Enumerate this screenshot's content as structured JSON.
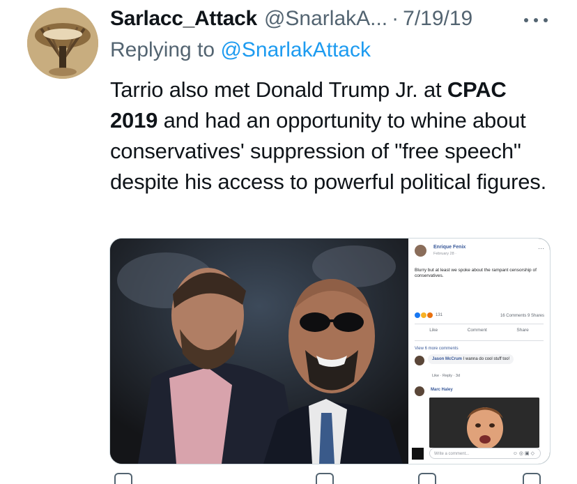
{
  "tweet": {
    "display_name": "Sarlacc_Attack",
    "handle": "@SnarlakA...",
    "separator": "·",
    "date": "7/19/19",
    "reply_prefix": "Replying to ",
    "reply_to": "@SnarlakAttack",
    "text_part1": "Tarrio also met Donald Trump Jr. at ",
    "text_bold": "CPAC 2019",
    "text_part2": " and had an opportunity to whine about conservatives' suppression of \"free speech\" despite his access to powerful political figures."
  },
  "icons": [
    "more-icon",
    "avatar-icon"
  ],
  "embedded_facebook_post": {
    "author": "Enrique Fenix",
    "date": "February 28 · ",
    "more": "···",
    "post_text": "Blurry but at least we spoke about the rampant censorship of conservatives.",
    "reaction_count": "131",
    "counts": "16 Comments  9 Shares",
    "actions": [
      "Like",
      "Comment",
      "Share"
    ],
    "view_more": "View 6 more comments",
    "comment1_author": "Jason McCrum",
    "comment1_text": " I wanna do cool stuff too!",
    "comment1_meta": "Like · Reply · 3d",
    "comment2_author": "Marc Haley",
    "write_placeholder": "Write a comment..."
  },
  "colors": {
    "link": "#1d9bf0",
    "muted": "#536471",
    "text": "#0f1419"
  }
}
